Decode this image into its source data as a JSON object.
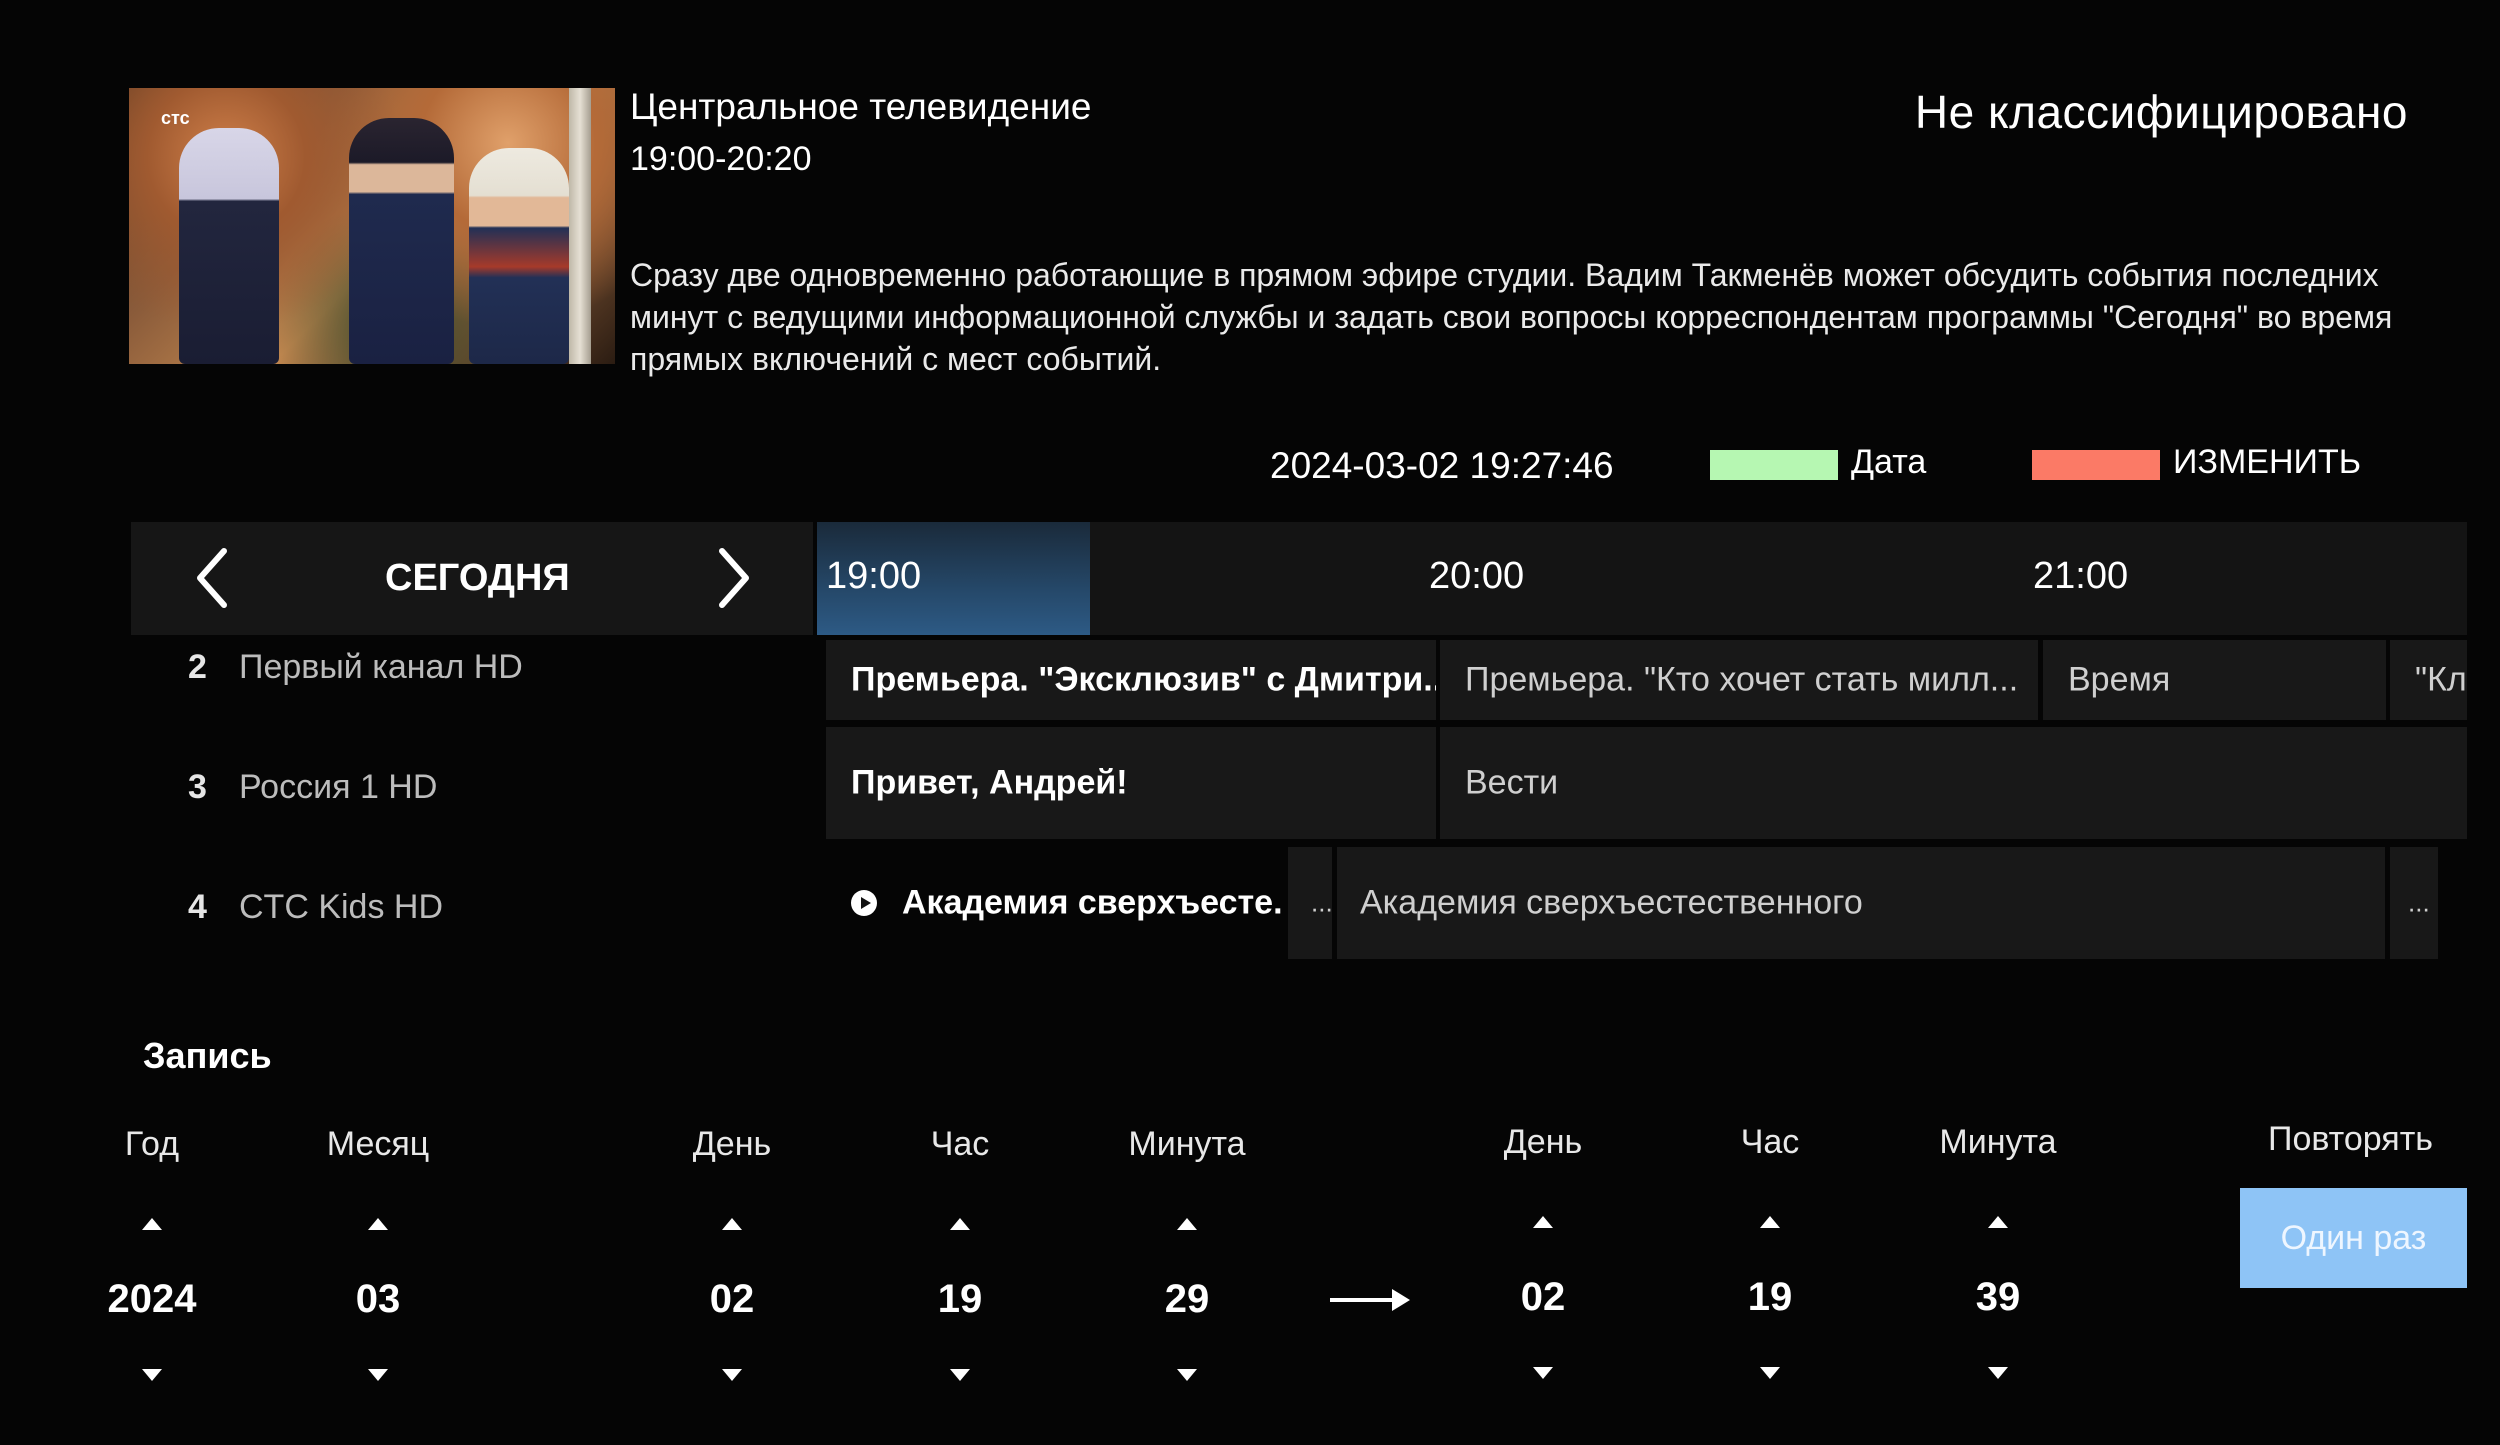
{
  "program": {
    "channel_title": "Центральное телевидение",
    "time_range": "19:00-20:20",
    "rating": "Не классифицировано",
    "thumbnail_logo": "стс",
    "description": "Сразу две одновременно работающие в прямом эфире студии. Вадим Такменёв может обсудить события последних минут с ведущими информационной службы и задать свои вопросы корреспондентам программы \"Сегодня\" во время прямых включений с мест событий."
  },
  "status": {
    "datetime": "2024-03-02 19:27:46",
    "green_label": "Дата",
    "green_color": "#b6f7b2",
    "red_label": "ИЗМЕНИТЬ",
    "red_color": "#fb7a66"
  },
  "epg": {
    "day_label": "СЕГОДНЯ",
    "times": [
      "19:00",
      "20:00",
      "21:00"
    ],
    "channels": [
      {
        "number": "2",
        "name": "Первый канал HD",
        "programs": [
          "Премьера. \"Эксклюзив\" с Дмитри...",
          "Премьера. \"Кто хочет стать милл...",
          "Время",
          "\"Кл"
        ]
      },
      {
        "number": "3",
        "name": "Россия 1 HD",
        "programs": [
          "Привет, Андрей!",
          "Вести"
        ]
      },
      {
        "number": "4",
        "name": "CTC Kids HD",
        "programs": [
          "Академия сверхъесте...",
          "...",
          "Академия сверхъестественного",
          "..."
        ]
      }
    ]
  },
  "record": {
    "title": "Запись",
    "start": {
      "year_label": "Год",
      "year": "2024",
      "month_label": "Месяц",
      "month": "03",
      "day_label": "День",
      "day": "02",
      "hour_label": "Час",
      "hour": "19",
      "minute_label": "Минута",
      "minute": "29"
    },
    "end": {
      "day_label": "День",
      "day": "02",
      "hour_label": "Час",
      "hour": "19",
      "minute_label": "Минута",
      "minute": "39"
    },
    "repeat_label": "Повторять",
    "repeat_value": "Один раз",
    "repeat_color": "#8ec4f6"
  }
}
